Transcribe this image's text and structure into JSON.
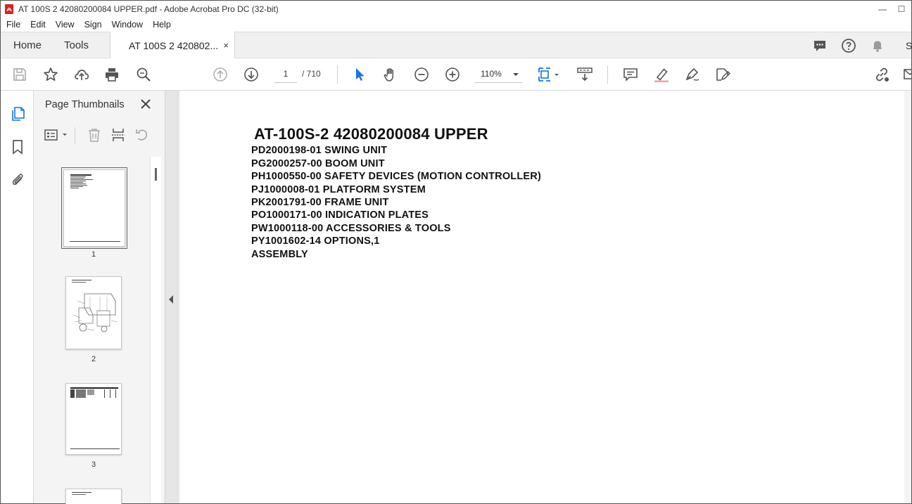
{
  "window": {
    "title": "AT 100S 2 42080200084 UPPER.pdf - Adobe Acrobat Pro DC (32-bit)",
    "minimize_glyph": "—",
    "maximize_glyph": "☐"
  },
  "menu": [
    "File",
    "Edit",
    "View",
    "Sign",
    "Window",
    "Help"
  ],
  "tabs": {
    "home": "Home",
    "tools": "Tools",
    "document": "AT 100S 2 420802...",
    "close_glyph": "×",
    "overflow_label": "S"
  },
  "toolbar": {
    "current_page": "1",
    "total_pages": "/ 710",
    "zoom": "110%"
  },
  "panel": {
    "title": "Page Thumbnails",
    "thumbnails": [
      {
        "label": "1"
      },
      {
        "label": "2"
      },
      {
        "label": "3"
      }
    ]
  },
  "document": {
    "title": "AT-100S-2 42080200084 UPPER",
    "lines": [
      "PD2000198-01 SWING UNIT",
      "PG2000257-00 BOOM UNIT",
      "PH1000550-00 SAFETY DEVICES (MOTION CONTROLLER)",
      "PJ1000008-01 PLATFORM SYSTEM",
      "PK2001791-00 FRAME UNIT",
      "PO1000171-00 INDICATION PLATES",
      "PW1000118-00 ACCESSORIES & TOOLS",
      "PY1001602-14 OPTIONS,1",
      "ASSEMBLY"
    ]
  },
  "colors": {
    "accent_blue": "#1473e6",
    "icon_gray": "#555555",
    "icon_disabled": "#b0b0b0",
    "acrobat_red": "#d8231f"
  }
}
